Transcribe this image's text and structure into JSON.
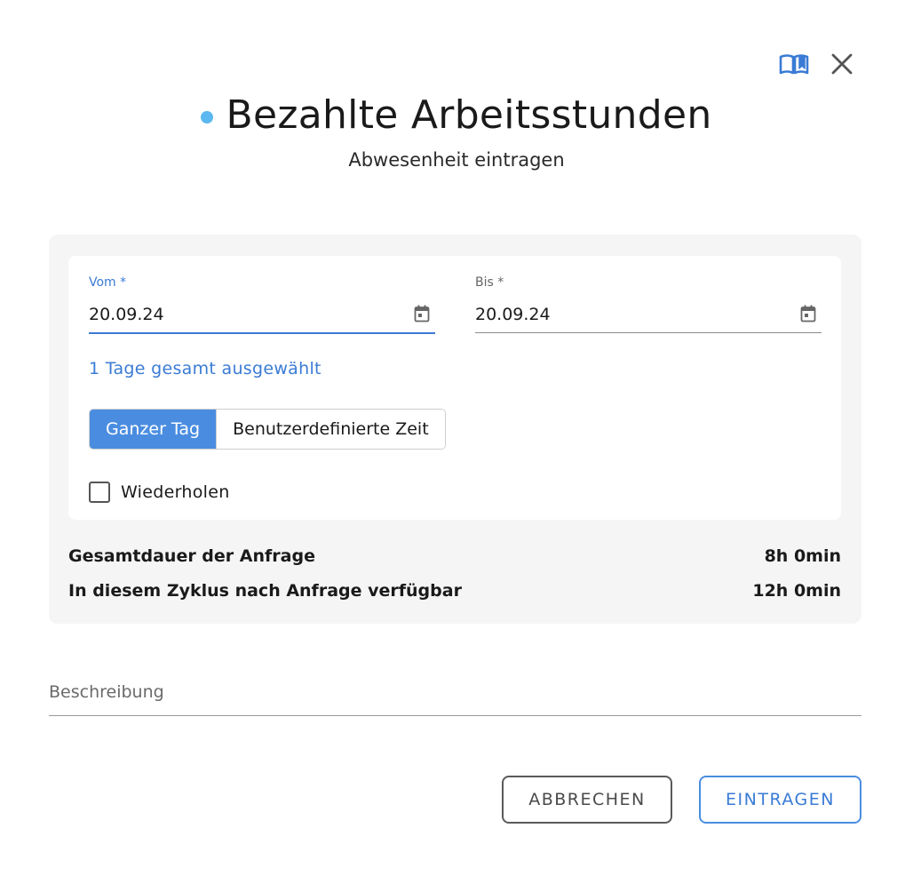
{
  "header": {
    "title": "Bezahlte Arbeitsstunden",
    "subtitle": "Abwesenheit eintragen",
    "dot_color": "#5bb8f0",
    "help_icon": "book-open-icon",
    "close_icon": "close-icon"
  },
  "form": {
    "from": {
      "label": "Vom *",
      "value": "20.09.24"
    },
    "to": {
      "label": "Bis *",
      "value": "20.09.24"
    },
    "calendar_icon": "calendar-icon",
    "days_info": "1 Tage gesamt ausgewählt",
    "toggle": {
      "options": [
        "Ganzer Tag",
        "Benutzerdefinierte Zeit"
      ],
      "selected": "Ganzer Tag"
    },
    "repeat": {
      "label": "Wiederholen",
      "checked": false
    }
  },
  "summary": {
    "total_label": "Gesamtdauer der Anfrage",
    "total_value": "8h 0min",
    "available_label": "In diesem Zyklus nach Anfrage verfügbar",
    "available_value": "12h 0min"
  },
  "description": {
    "placeholder": "Beschreibung",
    "value": ""
  },
  "actions": {
    "cancel_label": "ABBRECHEN",
    "submit_label": "EINTRAGEN"
  },
  "colors": {
    "accent": "#4a8de0",
    "accent_text": "#3a7bd5",
    "panel_bg": "#f5f5f5"
  }
}
